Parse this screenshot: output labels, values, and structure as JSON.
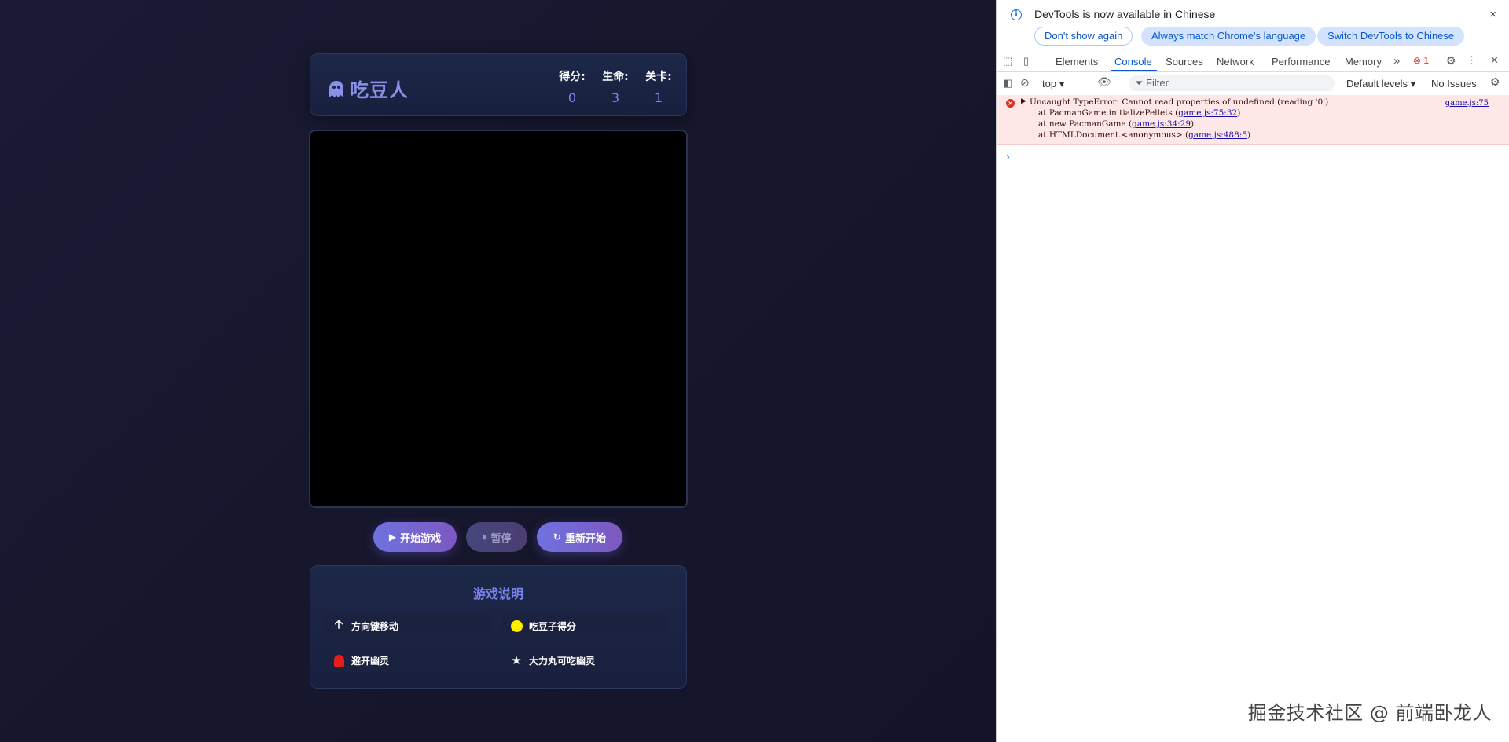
{
  "game": {
    "title": "吃豆人",
    "stats": [
      {
        "label": "得分:",
        "value": "0"
      },
      {
        "label": "生命:",
        "value": "3"
      },
      {
        "label": "关卡:",
        "value": "1"
      }
    ],
    "buttons": {
      "start": "开始游戏",
      "pause": "暂停",
      "restart": "重新开始"
    },
    "instructions": {
      "title": "游戏说明",
      "items": [
        "方向键移动",
        "吃豆子得分",
        "避开幽灵",
        "大力丸可吃幽灵"
      ]
    },
    "colors": {
      "accent": "#7d86f0",
      "pellet": "#ffee00",
      "ghost": "#e81b1b"
    }
  },
  "devtools": {
    "banner": {
      "message": "DevTools is now available in Chinese",
      "dont_show": "Don't show again",
      "always_match": "Always match Chrome's language",
      "switch": "Switch DevTools to Chinese",
      "close": "×"
    },
    "tabs": [
      "Elements",
      "Console",
      "Sources",
      "Network",
      "Performance",
      "Memory"
    ],
    "active_tab": "Console",
    "more_tabs": "»",
    "error_count": "1",
    "toolbar": {
      "context": "top",
      "filter_placeholder": "Filter",
      "levels": "Default levels",
      "issues": "No Issues"
    },
    "console": {
      "error_message": "Uncaught TypeError: Cannot read properties of undefined (reading '0')",
      "error_source": "game.js:75",
      "stack": [
        {
          "prefix": "at PacmanGame.initializePellets (",
          "link": "game.js:75:32",
          "suffix": ")"
        },
        {
          "prefix": "at new PacmanGame (",
          "link": "game.js:34:29",
          "suffix": ")"
        },
        {
          "prefix": "at HTMLDocument.<anonymous> (",
          "link": "game.js:488:5",
          "suffix": ")"
        }
      ],
      "prompt": "›"
    }
  },
  "watermark": "掘金技术社区 @ 前端卧龙人"
}
